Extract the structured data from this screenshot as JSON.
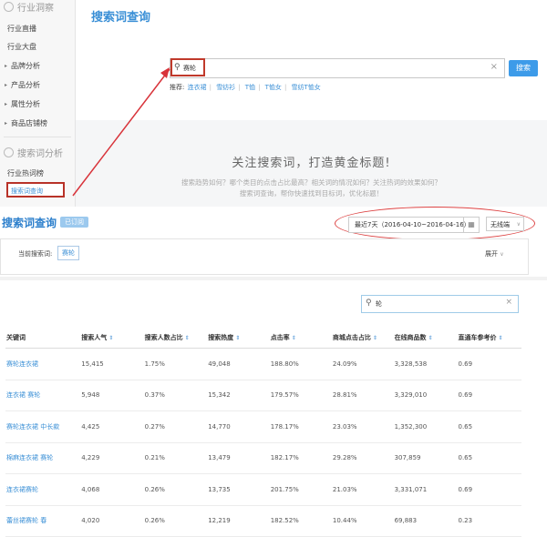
{
  "sidebar": {
    "section1_title": "行业洞察",
    "items1": [
      {
        "label": "行业直播",
        "arrow": ""
      },
      {
        "label": "行业大盘",
        "arrow": ""
      },
      {
        "label": "品牌分析",
        "arrow": "▸"
      },
      {
        "label": "产品分析",
        "arrow": "▸"
      },
      {
        "label": "属性分析",
        "arrow": "▸"
      },
      {
        "label": "商品店铺榜",
        "arrow": "▸"
      }
    ],
    "section2_title": "搜索词分析",
    "items2": [
      {
        "label": "行业热词榜"
      },
      {
        "label": "搜索词查询"
      }
    ]
  },
  "top": {
    "title": "搜索词查询",
    "search_value": "赛轮",
    "search_button": "搜索",
    "recommend_label": "推荐:",
    "recommend_links": [
      "连衣裙",
      "雪纺衫",
      "T恤",
      "T恤女",
      "雪纺T恤女"
    ],
    "slogan": "关注搜索词，打造黄金标题!",
    "desc_line1": "搜索趋势如何？哪个类目的点击占比最高？相关词的情况如何？关注热词的效果如何？",
    "desc_line2": "搜索词查询，帮你快速找到目标词，优化标题！"
  },
  "bottom": {
    "title": "搜索词查询",
    "badge": "已订阅",
    "date_range": "最近7天（2016-04-10~2016-04-16）",
    "terminal": "无线端",
    "current_label": "当前搜索词:",
    "current_term": "赛轮",
    "expand": "展开",
    "filter_value": "轮",
    "table": {
      "headers": [
        "关键词",
        "搜索人气",
        "搜索人数占比",
        "搜索热度",
        "点击率",
        "商城点击占比",
        "在线商品数",
        "直通车参考价"
      ],
      "rows": [
        [
          "赛轮连衣裙",
          "15,415",
          "1.75%",
          "49,048",
          "188.80%",
          "24.09%",
          "3,328,538",
          "0.69"
        ],
        [
          "连衣裙 赛轮",
          "5,948",
          "0.37%",
          "15,342",
          "179.57%",
          "28.81%",
          "3,329,010",
          "0.69"
        ],
        [
          "赛轮连衣裙 中长款",
          "4,425",
          "0.27%",
          "14,770",
          "178.17%",
          "23.03%",
          "1,352,300",
          "0.65"
        ],
        [
          "棉麻连衣裙 赛轮",
          "4,229",
          "0.21%",
          "13,479",
          "182.17%",
          "29.28%",
          "307,859",
          "0.65"
        ],
        [
          "连衣裙赛轮",
          "4,068",
          "0.26%",
          "13,735",
          "201.75%",
          "21.03%",
          "3,331,071",
          "0.69"
        ],
        [
          "蕾丝裙赛轮 春",
          "4,020",
          "0.26%",
          "12,219",
          "182.52%",
          "10.44%",
          "69,883",
          "0.23"
        ]
      ]
    }
  },
  "colors": {
    "accent": "#3a8fd6",
    "highlight_red": "#c0392b",
    "button_blue": "#3d9be9"
  },
  "icons": {
    "search": "search-icon",
    "clear": "clear-icon",
    "calendar": "calendar-icon",
    "sort": "sort-icon"
  }
}
